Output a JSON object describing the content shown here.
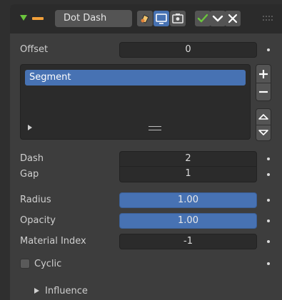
{
  "header": {
    "modifier_name": "Dot Dash",
    "expand_icon": "triangle-down-icon",
    "modifier_type_icon": "dash-line-icon",
    "vis_icons": [
      "edit-mode-icon",
      "viewport-icon",
      "render-icon"
    ],
    "apply_icons": [
      "checkmark-icon",
      "chevron-down-icon",
      "close-icon"
    ],
    "drag_icon": "grip-dots-icon",
    "accent_color": "#6bc53d",
    "modifier_color": "#f2a03a"
  },
  "offset": {
    "label": "Offset",
    "value": "0"
  },
  "segments": {
    "items": [
      "Segment"
    ],
    "add_icon": "plus-icon",
    "remove_icon": "minus-icon",
    "move_up_icon": "chevron-up-icon",
    "move_down_icon": "chevron-down-icon"
  },
  "dash": {
    "label": "Dash",
    "value": "2"
  },
  "gap": {
    "label": "Gap",
    "value": "1"
  },
  "radius": {
    "label": "Radius",
    "value": "1.00"
  },
  "opacity": {
    "label": "Opacity",
    "value": "1.00"
  },
  "material_index": {
    "label": "Material Index",
    "value": "-1"
  },
  "cyclic": {
    "label": "Cyclic",
    "checked": false
  },
  "influence": {
    "label": "Influence"
  },
  "colors": {
    "active_blue": "#4772b3",
    "panel_bg": "#3d3d3d",
    "field_bg": "#2b2b2b"
  }
}
